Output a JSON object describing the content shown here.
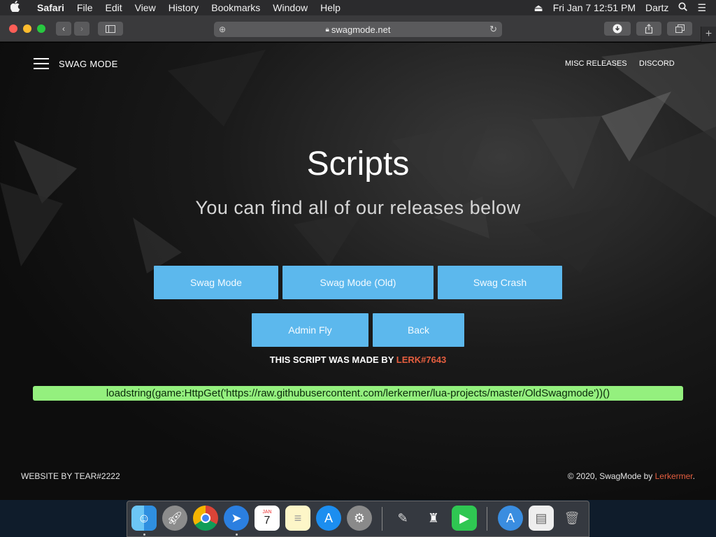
{
  "menubar": {
    "apple": "",
    "app": "Safari",
    "items": [
      "File",
      "Edit",
      "View",
      "History",
      "Bookmarks",
      "Window",
      "Help"
    ],
    "datetime": "Fri Jan 7  12:51 PM",
    "user": "Dartz"
  },
  "browser": {
    "url": "swagmode.net"
  },
  "site": {
    "brand": "SWAG MODE",
    "nav": {
      "misc": "MISC RELEASES",
      "discord": "DISCORD"
    },
    "title": "Scripts",
    "subtitle": "You can find all of our releases below",
    "buttons": {
      "swag_mode": "Swag Mode",
      "swag_mode_old": "Swag Mode (Old)",
      "swag_crash": "Swag Crash",
      "admin_fly": "Admin Fly",
      "back": "Back"
    },
    "credit_prefix": "THIS SCRIPT WAS MADE BY ",
    "credit_name": "LERK#7643",
    "code": "loadstring(game:HttpGet('https://raw.githubusercontent.com/lerkermer/lua-projects/master/OldSwagmode'))()",
    "footer_left": "WEBSITE BY TEAR#2222",
    "footer_right_prefix": "© 2020, SwagMode by ",
    "footer_author": "Lerkermer",
    "footer_suffix": "."
  },
  "dock": {
    "calendar_month": "JAN",
    "calendar_day": "7"
  },
  "colors": {
    "button": "#5cb8ed",
    "accent": "#e55e3f",
    "code_bg": "#94f07e"
  }
}
